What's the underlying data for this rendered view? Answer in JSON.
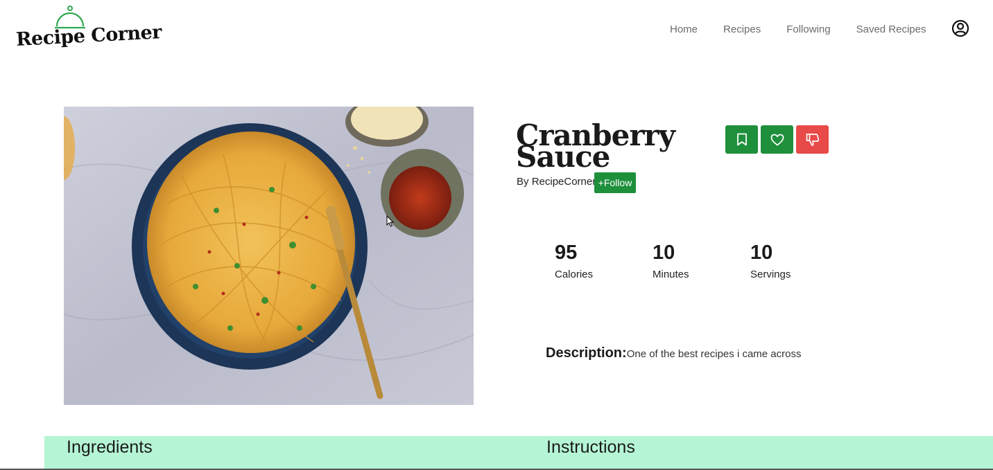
{
  "brand": {
    "name": "Recipe Corner",
    "logo_icon": "cloche-icon",
    "accent": "#2fa84f"
  },
  "nav": {
    "items": [
      "Home",
      "Recipes",
      "Following",
      "Saved Recipes"
    ],
    "profile_icon": "user-circle-icon"
  },
  "recipe": {
    "title": "Cranberry Sauce",
    "by_label": "By",
    "author": "RecipeCorner",
    "follow_label": "+Follow",
    "image_alt": "Spaghetti with chili flakes and parmesan",
    "stats": [
      {
        "value": "95",
        "label": "Calories"
      },
      {
        "value": "10",
        "label": "Minutes"
      },
      {
        "value": "10",
        "label": "Servings"
      }
    ],
    "description_label": "Description:",
    "description": "One of the best recipes i came across"
  },
  "actions": {
    "save_icon": "bookmark-icon",
    "like_icon": "heart-icon",
    "dislike_icon": "thumbs-down-icon"
  },
  "sections": {
    "ingredients_title": "Ingredients",
    "instructions_title": "Instructions"
  },
  "colors": {
    "button_green": "#1e8f3b",
    "button_red": "#e84a4a",
    "band": "#b5f5d5"
  }
}
